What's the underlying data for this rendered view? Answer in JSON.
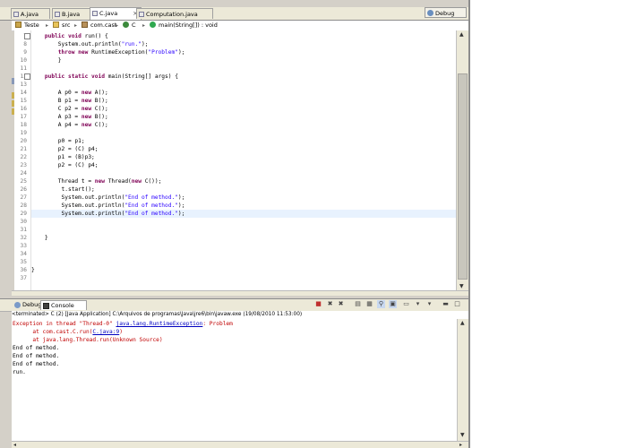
{
  "editor_tabs": [
    {
      "label": "A.java"
    },
    {
      "label": "B.java"
    },
    {
      "label": "C.java"
    },
    {
      "label": "Computation.java"
    }
  ],
  "perspective": {
    "label": "Debug"
  },
  "breadcrumb": {
    "project": "Teste",
    "folder": "src",
    "package": "com.cast",
    "class": "C",
    "method": "main(String[]) : void"
  },
  "code_lines": [
    {
      "num": "7",
      "parts": [
        [
          "    ",
          ""
        ],
        [
          "public void",
          "kw"
        ],
        [
          " run() {",
          ""
        ]
      ]
    },
    {
      "num": "8",
      "parts": [
        [
          "        System.out.println(",
          ""
        ],
        [
          "\"run.\"",
          "str"
        ],
        [
          ");",
          ""
        ]
      ]
    },
    {
      "num": "9",
      "parts": [
        [
          "        ",
          ""
        ],
        [
          "throw new",
          "kw"
        ],
        [
          " RuntimeException(",
          ""
        ],
        [
          "\"Problem\"",
          "str"
        ],
        [
          ");",
          ""
        ]
      ]
    },
    {
      "num": "10",
      "parts": [
        [
          "        }",
          ""
        ]
      ]
    },
    {
      "num": "11",
      "parts": [
        [
          "",
          ""
        ]
      ]
    },
    {
      "num": "12",
      "parts": [
        [
          "    ",
          ""
        ],
        [
          "public static void",
          "kw"
        ],
        [
          " main(String[] args) {",
          ""
        ]
      ]
    },
    {
      "num": "13",
      "parts": [
        [
          "",
          ""
        ]
      ]
    },
    {
      "num": "14",
      "parts": [
        [
          "        A p0 = ",
          ""
        ],
        [
          "new",
          "kw"
        ],
        [
          " A();",
          ""
        ]
      ]
    },
    {
      "num": "15",
      "parts": [
        [
          "        B p1 = ",
          ""
        ],
        [
          "new",
          "kw"
        ],
        [
          " B();",
          ""
        ]
      ]
    },
    {
      "num": "16",
      "parts": [
        [
          "        C p2 = ",
          ""
        ],
        [
          "new",
          "kw"
        ],
        [
          " C();",
          ""
        ]
      ]
    },
    {
      "num": "17",
      "parts": [
        [
          "        A p3 = ",
          ""
        ],
        [
          "new",
          "kw"
        ],
        [
          " B();",
          ""
        ]
      ]
    },
    {
      "num": "18",
      "parts": [
        [
          "        A p4 = ",
          ""
        ],
        [
          "new",
          "kw"
        ],
        [
          " C();",
          ""
        ]
      ]
    },
    {
      "num": "19",
      "parts": [
        [
          "",
          ""
        ]
      ]
    },
    {
      "num": "20",
      "parts": [
        [
          "        p0 = p1;",
          ""
        ]
      ]
    },
    {
      "num": "21",
      "parts": [
        [
          "        p2 = (C) p4;",
          ""
        ]
      ]
    },
    {
      "num": "22",
      "parts": [
        [
          "        p1 = (B)p3;",
          ""
        ]
      ]
    },
    {
      "num": "23",
      "parts": [
        [
          "        p2 = (C) p4;",
          ""
        ]
      ]
    },
    {
      "num": "24",
      "parts": [
        [
          "",
          ""
        ]
      ]
    },
    {
      "num": "25",
      "parts": [
        [
          "        Thread t = ",
          ""
        ],
        [
          "new",
          "kw"
        ],
        [
          " Thread(",
          ""
        ],
        [
          "new",
          "kw"
        ],
        [
          " C());",
          ""
        ]
      ]
    },
    {
      "num": "26",
      "parts": [
        [
          "         t.start();",
          ""
        ]
      ]
    },
    {
      "num": "27",
      "parts": [
        [
          "         System.out.println(",
          ""
        ],
        [
          "\"End of method.\"",
          "str"
        ],
        [
          ");",
          ""
        ]
      ]
    },
    {
      "num": "28",
      "parts": [
        [
          "         System.out.println(",
          ""
        ],
        [
          "\"End of method.\"",
          "str"
        ],
        [
          ");",
          ""
        ]
      ]
    },
    {
      "num": "29",
      "parts": [
        [
          "         System.out.println(",
          ""
        ],
        [
          "\"End of method.\"",
          "str"
        ],
        [
          ");",
          ""
        ]
      ],
      "highlight": true
    },
    {
      "num": "30",
      "parts": [
        [
          "",
          ""
        ]
      ]
    },
    {
      "num": "31",
      "parts": [
        [
          "",
          ""
        ]
      ]
    },
    {
      "num": "32",
      "parts": [
        [
          "    }",
          ""
        ]
      ]
    },
    {
      "num": "33",
      "parts": [
        [
          "",
          ""
        ]
      ]
    },
    {
      "num": "34",
      "parts": [
        [
          "",
          ""
        ]
      ]
    },
    {
      "num": "35",
      "parts": [
        [
          "",
          ""
        ]
      ]
    },
    {
      "num": "36",
      "parts": [
        [
          "}",
          ""
        ]
      ]
    },
    {
      "num": "37",
      "parts": [
        [
          "",
          ""
        ]
      ]
    }
  ],
  "console_tabs": [
    {
      "label": "Debug"
    },
    {
      "label": "Console"
    }
  ],
  "console_title": "<terminated> C (2) [Java Application] C:\\Arquivos de programas\\Java\\jre6\\bin\\javaw.exe (19/08/2010 11:53:00)",
  "console_lines": [
    {
      "parts": [
        [
          "Exception in thread \"Thread-0\" ",
          "err"
        ],
        [
          "java.lang.RuntimeException",
          "link"
        ],
        [
          ": Problem",
          "err"
        ]
      ]
    },
    {
      "parts": [
        [
          "      at com.cast.C.run(",
          "err"
        ],
        [
          "C.java:9",
          "link"
        ],
        [
          ")",
          "err"
        ]
      ]
    },
    {
      "parts": [
        [
          "      at java.lang.Thread.run(Unknown Source)",
          "err"
        ]
      ]
    },
    {
      "parts": [
        [
          "End of method.",
          ""
        ]
      ]
    },
    {
      "parts": [
        [
          "End of method.",
          ""
        ]
      ]
    },
    {
      "parts": [
        [
          "End of method.",
          ""
        ]
      ]
    },
    {
      "parts": [
        [
          "run.",
          ""
        ]
      ]
    }
  ],
  "colors": {
    "keyword": "#7f0055",
    "string": "#2a00ff",
    "error": "#c00000",
    "link": "#0000c0",
    "current_line": "#e8f2fe",
    "chrome": "#d4d0c8"
  },
  "console_toolbar_icons": [
    "terminate-icon",
    "remove-launch-icon",
    "remove-all-icon",
    "clear-console-icon",
    "scroll-lock-icon",
    "pin-console-icon",
    "display-console-icon",
    "open-console-icon",
    "minimize-icon",
    "maximize-icon"
  ]
}
